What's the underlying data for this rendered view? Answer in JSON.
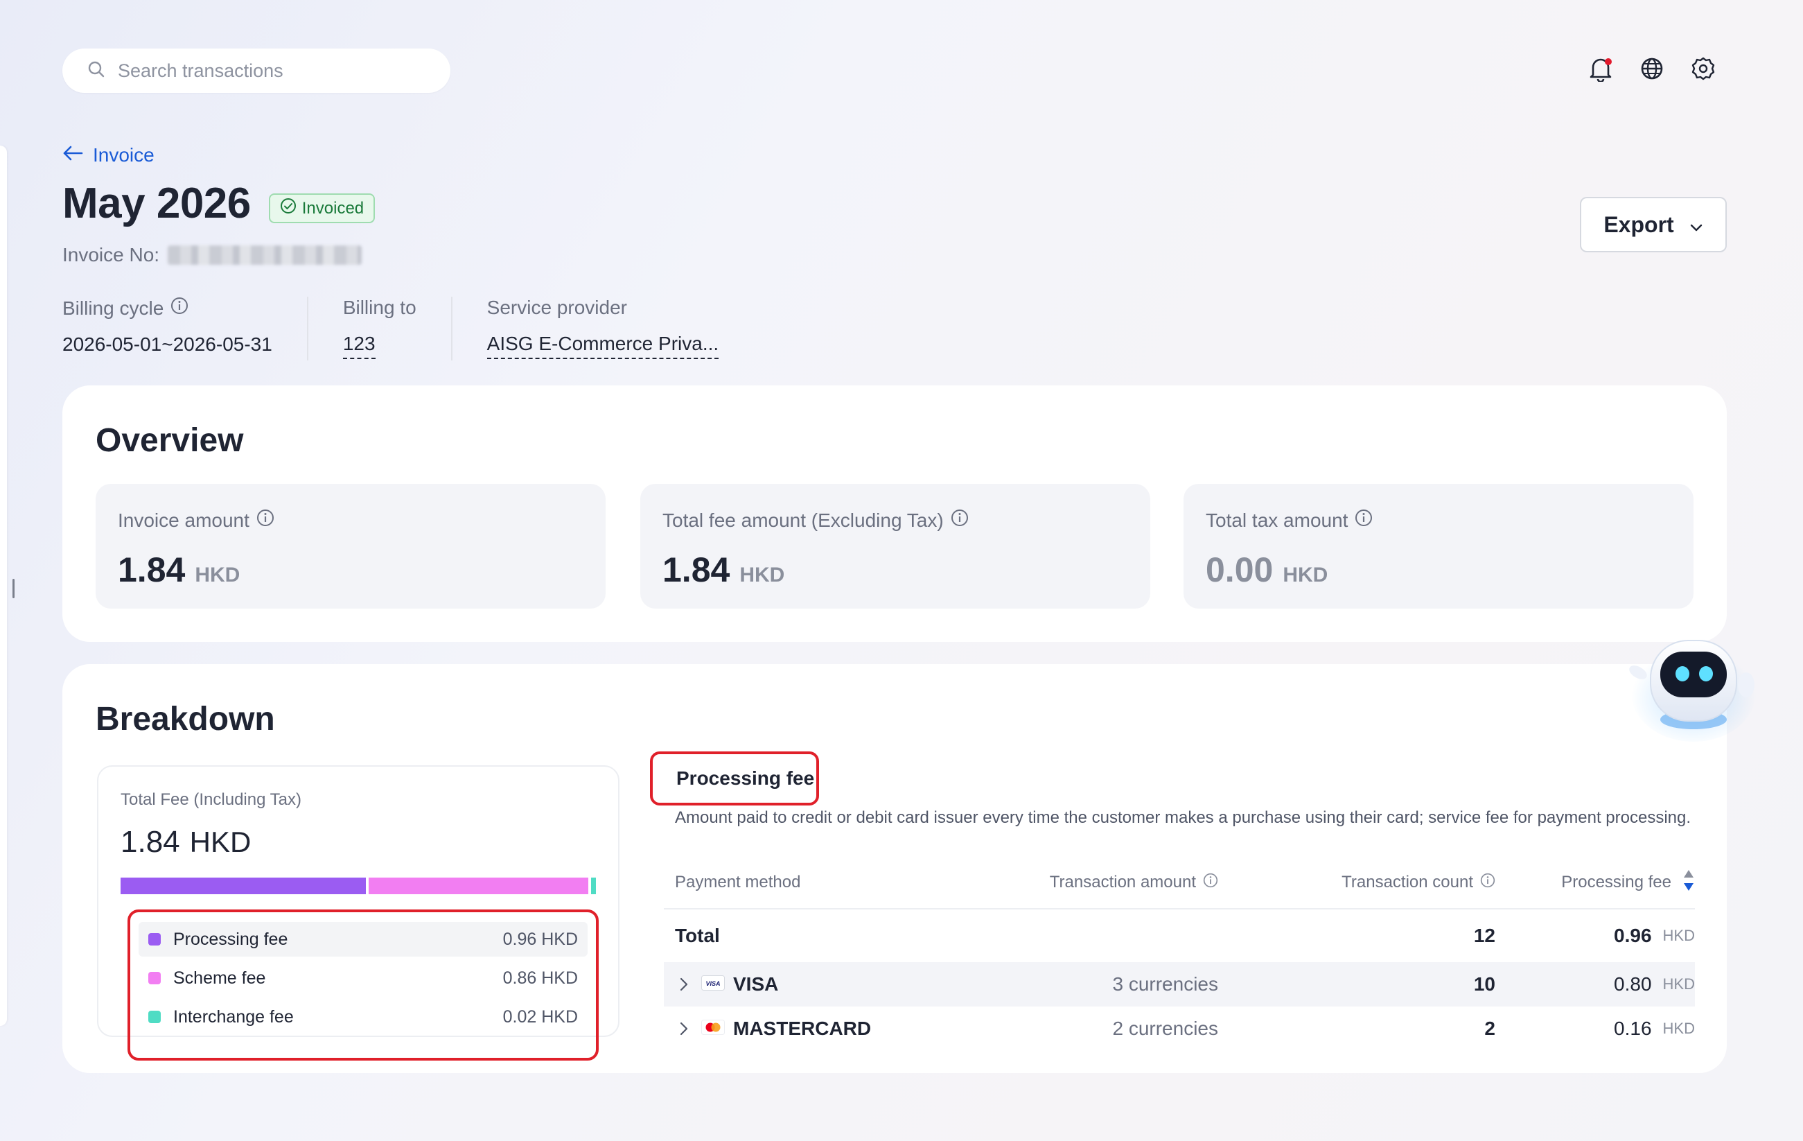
{
  "search": {
    "placeholder": "Search transactions"
  },
  "header": {
    "back_label": "Invoice",
    "title": "May 2026",
    "status": "Invoiced",
    "invoice_no_label": "Invoice No:",
    "export_label": "Export"
  },
  "meta": {
    "billing_cycle_label": "Billing cycle",
    "billing_cycle_value": "2026-05-01~2026-05-31",
    "billing_to_label": "Billing to",
    "billing_to_value": "123",
    "service_provider_label": "Service provider",
    "service_provider_value": "AISG E-Commerce Priva..."
  },
  "overview": {
    "title": "Overview",
    "stats": [
      {
        "label": "Invoice amount",
        "value": "1.84",
        "currency": "HKD"
      },
      {
        "label": "Total fee amount (Excluding Tax)",
        "value": "1.84",
        "currency": "HKD"
      },
      {
        "label": "Total tax amount",
        "value": "0.00",
        "currency": "HKD"
      }
    ]
  },
  "breakdown": {
    "title": "Breakdown",
    "total_label": "Total Fee (Including Tax)",
    "total_value": "1.84",
    "total_currency": "HKD",
    "segments": [
      {
        "name": "Processing fee",
        "value": "0.96 HKD",
        "amount": 0.96,
        "color": "#9b5cf2"
      },
      {
        "name": "Scheme fee",
        "value": "0.86 HKD",
        "amount": 0.86,
        "color": "#f27ef2"
      },
      {
        "name": "Interchange fee",
        "value": "0.02 HKD",
        "amount": 0.02,
        "color": "#4fdcc4"
      }
    ],
    "tab_label": "Processing fee",
    "description": "Amount paid to credit or debit card issuer every time the customer makes a purchase using their card; service fee for payment processing.",
    "table": {
      "headers": {
        "method": "Payment method",
        "amount": "Transaction amount",
        "count": "Transaction count",
        "fee": "Processing fee"
      },
      "total": {
        "label": "Total",
        "count": "12",
        "fee": "0.96",
        "unit": "HKD"
      },
      "rows": [
        {
          "method": "VISA",
          "amount": "3 currencies",
          "count": "10",
          "fee": "0.80",
          "unit": "HKD"
        },
        {
          "method": "MASTERCARD",
          "amount": "2 currencies",
          "count": "2",
          "fee": "0.16",
          "unit": "HKD"
        }
      ]
    }
  },
  "colors": {
    "accent": "#1a5bd6",
    "highlight_border": "#e0202a",
    "notification_dot": "#e2192c"
  },
  "icons": [
    "search-icon",
    "bell-icon",
    "globe-icon",
    "gear-icon",
    "arrow-left-icon",
    "check-circle-icon",
    "chevron-down-icon",
    "info-icon",
    "sort-icon",
    "chevron-right-icon",
    "visa-logo-icon",
    "mastercard-logo-icon",
    "assistant-robot-icon"
  ]
}
